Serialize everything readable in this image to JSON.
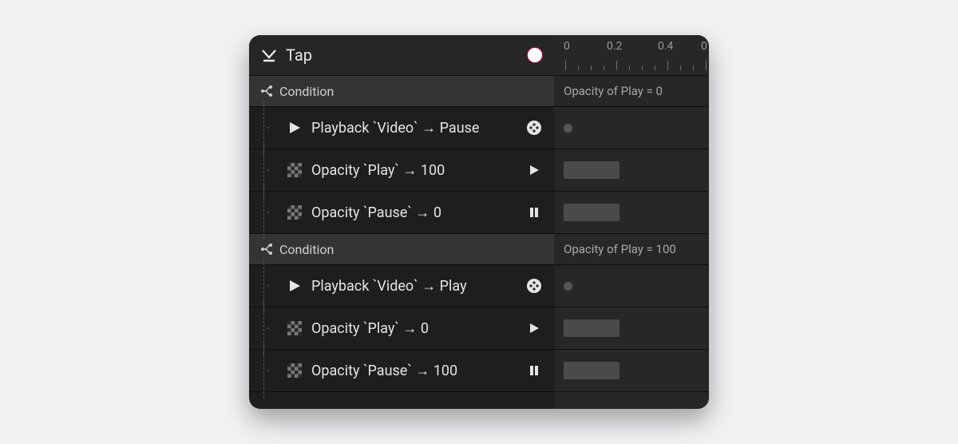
{
  "header": {
    "title": "Tap",
    "ruler_ticks": [
      "0",
      "0.2",
      "0.4",
      "0"
    ]
  },
  "conditions": [
    {
      "label": "Condition",
      "summary": "Opacity of Play = 0",
      "actions": [
        {
          "icon": "play",
          "text": "Playback `Video` → Pause",
          "badge": "film",
          "timeline": "dot"
        },
        {
          "icon": "checker",
          "text": "Opacity `Play` → 100",
          "badge": "play",
          "timeline": "bar"
        },
        {
          "icon": "checker",
          "text": "Opacity `Pause` → 0",
          "badge": "pause",
          "timeline": "bar"
        }
      ]
    },
    {
      "label": "Condition",
      "summary": "Opacity of Play = 100",
      "actions": [
        {
          "icon": "play",
          "text": "Playback `Video` → Play",
          "badge": "film",
          "timeline": "dot"
        },
        {
          "icon": "checker",
          "text": "Opacity `Play` → 0",
          "badge": "play",
          "timeline": "bar"
        },
        {
          "icon": "checker",
          "text": "Opacity `Pause` → 100",
          "badge": "pause",
          "timeline": "bar"
        }
      ]
    }
  ]
}
